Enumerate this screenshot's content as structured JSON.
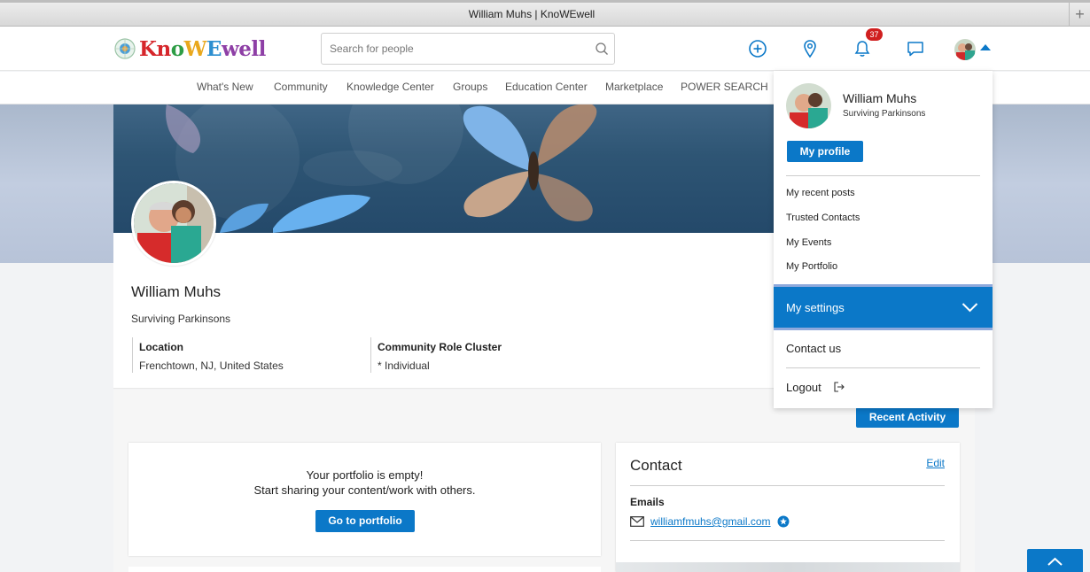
{
  "window": {
    "title": "William Muhs | KnoWEwell"
  },
  "header": {
    "logo": {
      "text": "KnoWEwell"
    },
    "search": {
      "placeholder": "Search for people",
      "value": ""
    },
    "notifications": {
      "count": "37"
    }
  },
  "nav": {
    "items": [
      "What's New",
      "Community",
      "Knowledge Center",
      "Groups",
      "Education Center",
      "Marketplace",
      "POWER SEARCH"
    ]
  },
  "profile": {
    "name": "William Muhs",
    "tagline": "Surviving Parkinsons",
    "fields": [
      {
        "label": "Location",
        "value": "Frenchtown, NJ, United States"
      },
      {
        "label": "Community Role Cluster",
        "value": "* Individual"
      }
    ]
  },
  "recent_activity_label": "Recent Activity",
  "portfolio": {
    "line1": "Your portfolio is empty!",
    "line2": "Start sharing your content/work with others.",
    "button": "Go to portfolio"
  },
  "contact": {
    "title": "Contact",
    "edit": "Edit",
    "emails_label": "Emails",
    "email": "williamfmuhs@gmail.com"
  },
  "dropdown": {
    "name": "William Muhs",
    "tagline": "Surviving Parkinsons",
    "profile_button": "My profile",
    "items": [
      "My recent posts",
      "Trusted Contacts",
      "My Events",
      "My Portfolio"
    ],
    "settings": "My settings",
    "contact": "Contact us",
    "logout": "Logout"
  },
  "colors": {
    "accent": "#0b78c8",
    "badge": "#d01f1f"
  }
}
